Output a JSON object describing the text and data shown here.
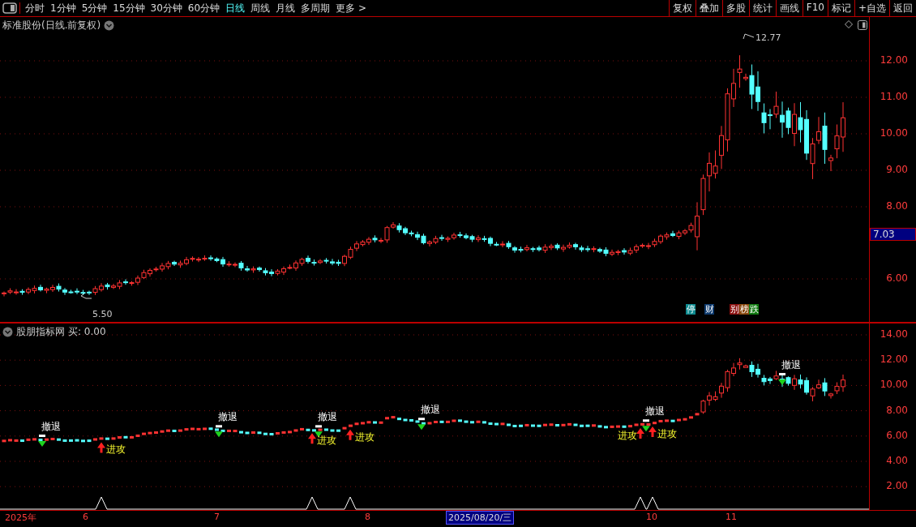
{
  "toolbar": {
    "tabs": [
      {
        "label": "分时",
        "selected": false
      },
      {
        "label": "1分钟",
        "selected": false
      },
      {
        "label": "5分钟",
        "selected": false
      },
      {
        "label": "15分钟",
        "selected": false
      },
      {
        "label": "30分钟",
        "selected": false
      },
      {
        "label": "60分钟",
        "selected": false
      },
      {
        "label": "日线",
        "selected": true
      },
      {
        "label": "周线",
        "selected": false
      },
      {
        "label": "月线",
        "selected": false
      },
      {
        "label": "多周期",
        "selected": false
      },
      {
        "label": "更多 >",
        "selected": false
      }
    ],
    "buttons": [
      "复权",
      "叠加",
      "多股",
      "统计",
      "画线",
      "F10",
      "标记",
      "+自选",
      "返回"
    ]
  },
  "main_chart": {
    "title": "标准股份(日线.前复权)",
    "y_ticks": [
      "12.00",
      "11.00",
      "10.00",
      "9.00",
      "8.00",
      "6.00"
    ],
    "high_label": "12.77",
    "low_label": "5.50",
    "current_price": "7.03",
    "badges": [
      {
        "label": "停",
        "color": "#0e8a8f"
      },
      {
        "label": "财",
        "color": "#0d3a6e"
      },
      {
        "label": "别",
        "color": "#8a1010"
      },
      {
        "label": "榜",
        "color": "#8a4a10"
      },
      {
        "label": "跌",
        "color": "#107a10"
      }
    ]
  },
  "indicator": {
    "name": "股朋指标网",
    "value": "买: 0.00",
    "y_ticks": [
      "14.00",
      "12.00",
      "10.00",
      "8.00",
      "6.00",
      "4.00",
      "2.00"
    ],
    "signals": [
      {
        "kind": "retreat",
        "label": "撤退"
      },
      {
        "kind": "attack",
        "label": "进攻"
      },
      {
        "kind": "retreat",
        "label": "撤退"
      },
      {
        "kind": "attack",
        "label": "进攻"
      },
      {
        "kind": "retreat",
        "label": "撤退"
      },
      {
        "kind": "attack",
        "label": "进攻"
      },
      {
        "kind": "retreat",
        "label": "撤退"
      },
      {
        "kind": "attack",
        "label": "进攻"
      },
      {
        "kind": "retreat",
        "label": "撤退"
      },
      {
        "kind": "attack",
        "label": "进攻"
      },
      {
        "kind": "retreat",
        "label": "撤退"
      }
    ]
  },
  "date_axis": [
    {
      "label": "2025年",
      "selected": false
    },
    {
      "label": "6",
      "selected": false
    },
    {
      "label": "7",
      "selected": false
    },
    {
      "label": "8",
      "selected": false
    },
    {
      "label": "2025/08/20/三",
      "selected": true
    },
    {
      "label": "10",
      "selected": false
    },
    {
      "label": "11",
      "selected": false
    }
  ]
}
